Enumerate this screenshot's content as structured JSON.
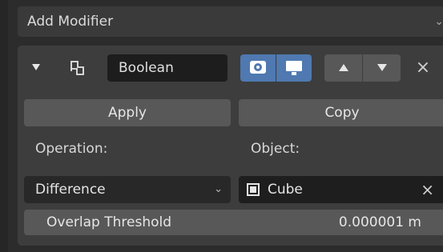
{
  "add_modifier": {
    "label": "Add Modifier",
    "chevron_icon": "chevron-down-icon"
  },
  "modifier": {
    "name": "Boolean",
    "icon": "boolean-modifier-icon",
    "visibility": {
      "render_icon": "camera-icon",
      "viewport_icon": "monitor-icon",
      "accent_color": "#4f79b0"
    },
    "move_up_icon": "triangle-up-icon",
    "move_down_icon": "triangle-down-icon",
    "close": "×"
  },
  "buttons": {
    "apply": "Apply",
    "copy": "Copy"
  },
  "fields": {
    "operation_label": "Operation:",
    "operation_value": "Difference",
    "object_label": "Object:",
    "object_value": "Cube",
    "object_clear": "×",
    "overlap_label": "Overlap Threshold",
    "overlap_value": "0.000001 m"
  }
}
